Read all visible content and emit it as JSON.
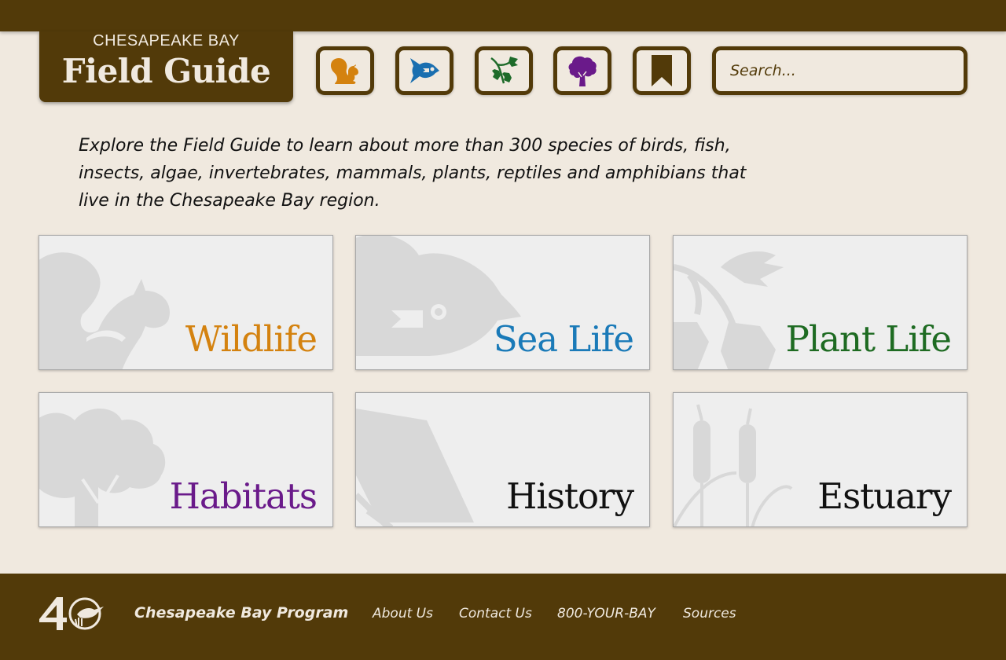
{
  "header": {
    "subtitle": "CHESAPEAKE BAY",
    "title": "Field Guide"
  },
  "nav_icons": [
    {
      "name": "squirrel-icon",
      "color": "#d4820f"
    },
    {
      "name": "fish-icon",
      "color": "#1a6fb0"
    },
    {
      "name": "leaf-branch-icon",
      "color": "#1e6b2a"
    },
    {
      "name": "tree-icon",
      "color": "#6a1a8a"
    },
    {
      "name": "bookmark-icon",
      "color": "#523a09"
    }
  ],
  "search": {
    "placeholder": "Search..."
  },
  "intro": "Explore the Field Guide to learn about more than 300 species of birds, fish, insects, algae, invertebrates, mammals, plants, reptiles and amphibians that live in the Chesapeake Bay region.",
  "cards": [
    {
      "label": "Wildlife",
      "color": "#d4820f"
    },
    {
      "label": "Sea Life",
      "color": "#1a7ab8"
    },
    {
      "label": "Plant Life",
      "color": "#1e6b22"
    },
    {
      "label": "Habitats",
      "color": "#6a1a8a"
    },
    {
      "label": "History",
      "color": "#111111"
    },
    {
      "label": "Estuary",
      "color": "#111111"
    }
  ],
  "footer": {
    "org": "Chesapeake Bay Program",
    "links": [
      "About Us",
      "Contact Us",
      "800-YOUR-BAY",
      "Sources"
    ]
  },
  "colors": {
    "brown": "#523a09",
    "cream": "#f0e9df"
  }
}
